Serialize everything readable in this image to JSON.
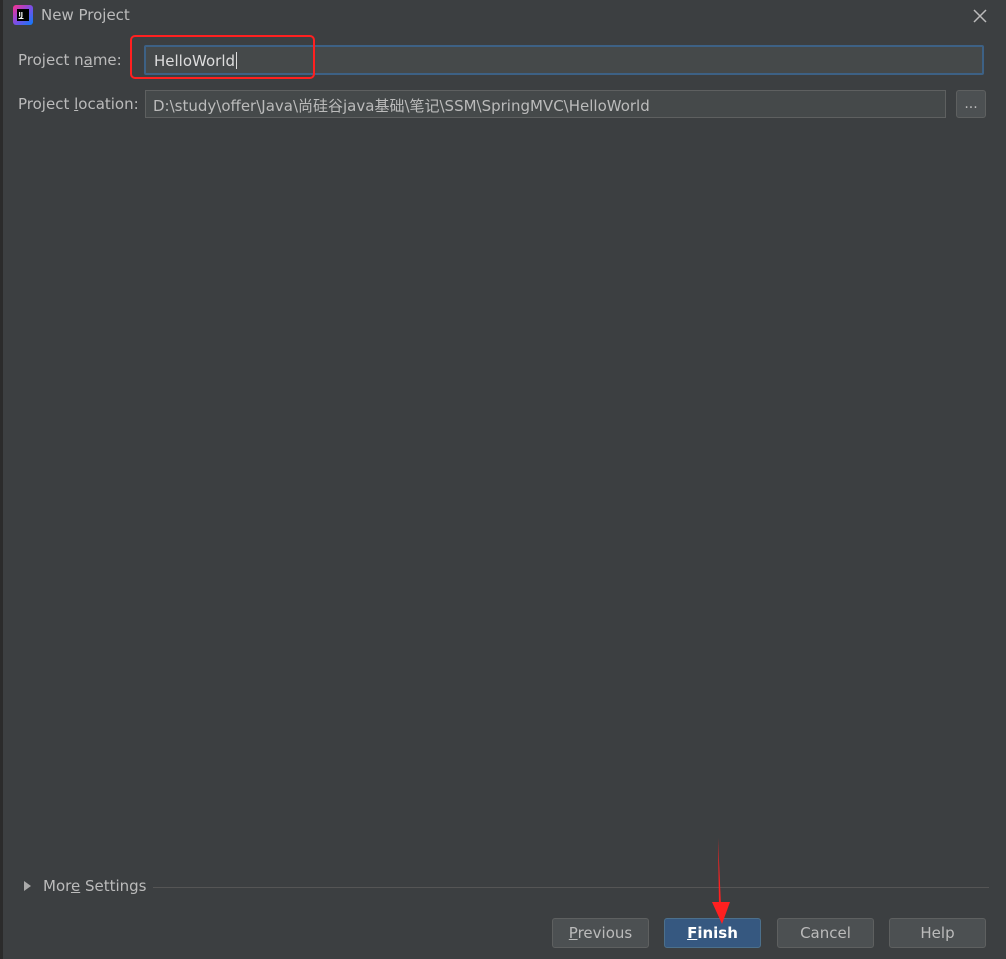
{
  "window": {
    "title": "New Project",
    "app_icon": "intellij-idea-icon",
    "close_icon": "close-icon"
  },
  "form": {
    "project_name_label": "Project name:",
    "project_name_value": "HelloWorld",
    "project_location_label": "Project location:",
    "project_location_value": "D:\\study\\offer\\Java\\尚硅谷java基础\\笔记\\SSM\\SpringMVC\\HelloWorld",
    "browse_label": "..."
  },
  "more_settings": {
    "label": "More Settings",
    "expanded": false
  },
  "buttons": {
    "previous": "Previous",
    "finish": "Finish",
    "cancel": "Cancel",
    "help": "Help"
  },
  "colors": {
    "background": "#3c3f41",
    "input_background": "#45494a",
    "focus_border": "#3d6185",
    "primary_button": "#365880",
    "annotation": "#ff2020"
  }
}
